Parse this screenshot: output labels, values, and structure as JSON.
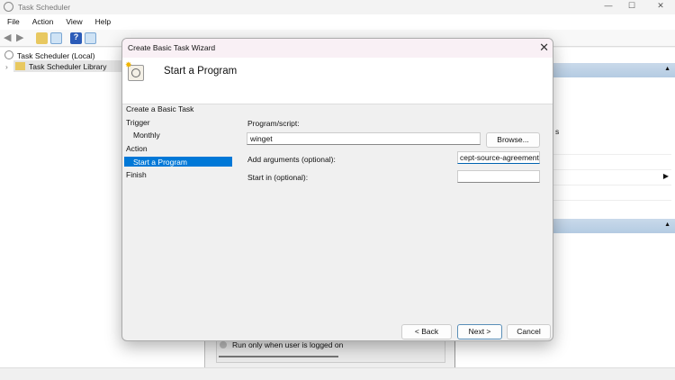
{
  "app": {
    "title": "Task Scheduler",
    "menu": [
      "File",
      "Action",
      "View",
      "Help"
    ],
    "tree": [
      "Task Scheduler (Local)",
      "Task Scheduler Library"
    ],
    "background_text": {
      "run_option": "Run only when user is logged on",
      "partial": "s"
    }
  },
  "dialog": {
    "title": "Create Basic Task Wizard",
    "heading": "Start a Program",
    "steps": [
      {
        "label": "Create a Basic Task",
        "indent": false
      },
      {
        "label": "Trigger",
        "indent": false
      },
      {
        "label": "Monthly",
        "indent": true
      },
      {
        "label": "Action",
        "indent": false
      },
      {
        "label": "Start a Program",
        "indent": true,
        "selected": true
      },
      {
        "label": "Finish",
        "indent": false
      }
    ],
    "program_label": "Program/script:",
    "program_value": "winget",
    "browse": "Browse...",
    "args_label": "Add arguments (optional):",
    "args_value": "cept-source-agreements",
    "startin_label": "Start in (optional):",
    "startin_value": "",
    "back": "< Back",
    "next": "Next >",
    "cancel": "Cancel"
  },
  "colors": {
    "selection": "#0078d7",
    "actions_header": "#c0d4e8"
  }
}
